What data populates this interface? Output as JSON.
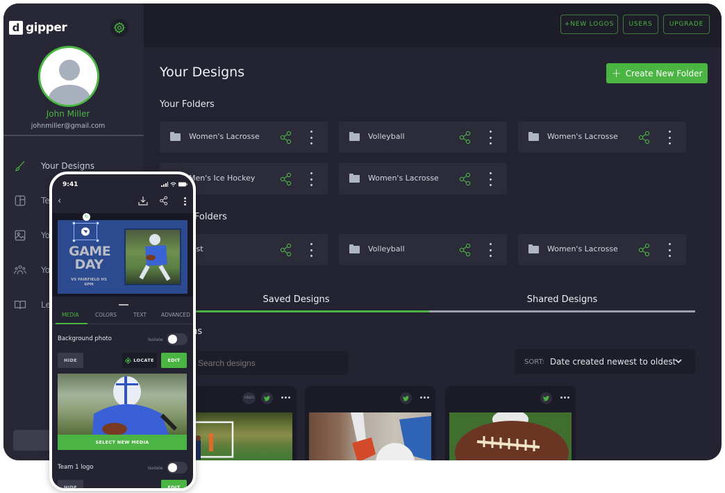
{
  "brand": {
    "name": "gipper",
    "logo_glyph": "d",
    "accent": "#4bb543"
  },
  "sidebar": {
    "settings_icon": "gear-icon",
    "user": {
      "name": "John Miller",
      "email": "johnmiller@gmail.com"
    },
    "items": [
      {
        "label": "Your Designs",
        "icon": "paintbrush-icon",
        "active": true
      },
      {
        "label": "Templates",
        "icon": "template-icon",
        "visible_text": "Te"
      },
      {
        "label": "Your Media",
        "icon": "image-icon",
        "visible_text": "Yo"
      },
      {
        "label": "Your Team",
        "icon": "users-icon",
        "visible_text": "Yo"
      },
      {
        "label": "Learn",
        "icon": "book-icon",
        "visible_text": "Le"
      }
    ]
  },
  "topbar": {
    "buttons": [
      {
        "label": "+NEW LOGOS"
      },
      {
        "label": "USERS"
      },
      {
        "label": "UPGRADE"
      }
    ]
  },
  "main": {
    "title": "Your Designs",
    "create_folder_label": "Create New Folder",
    "your_folders": {
      "title": "Your Folders",
      "items": [
        {
          "name": "Women's Lacrosse"
        },
        {
          "name": "Volleyball"
        },
        {
          "name": "Women's Lacrosse"
        },
        {
          "name": "Men's Ice Hockey",
          "visible_text": "len's Ice Hockey"
        },
        {
          "name": "Women's Lacrosse"
        }
      ]
    },
    "shared_folders": {
      "title": "Shared Folders",
      "visible_title": "ders",
      "items": [
        {
          "name": "...st",
          "visible_text": "st"
        },
        {
          "name": "Volleyball"
        },
        {
          "name": "Women's Lacrosse"
        }
      ]
    },
    "tabs": [
      {
        "label": "Saved Designs",
        "active": true
      },
      {
        "label": "Shared Designs",
        "active": false
      }
    ],
    "designs_title_visible": "r Designs",
    "search": {
      "placeholder": "Search designs"
    },
    "sort": {
      "label": "SORT:",
      "value": "Date created newest to oldest"
    },
    "cards": [
      {
        "video_badge": "VIDEO",
        "social": "twitter-icon",
        "thumb": "soccer-field"
      },
      {
        "social": "twitter-icon",
        "thumb": "soccer-kick"
      },
      {
        "social": "twitter-icon",
        "thumb": "football-wilson"
      }
    ]
  },
  "phone": {
    "time": "9:41",
    "design": {
      "headline": "GAME DAY",
      "line1": "VS FAIRFIELD HS",
      "line2": "6PM"
    },
    "tabs": [
      {
        "label": "MEDIA",
        "active": true
      },
      {
        "label": "COLORS"
      },
      {
        "label": "TEXT"
      },
      {
        "label": "ADVANCED"
      }
    ],
    "background_photo": {
      "label": "Background photo",
      "isolate_label": "Isolate",
      "hide_label": "HIDE",
      "locate_label": "LOCATE",
      "edit_label": "EDIT",
      "select_media_label": "SELECT NEW MEDIA"
    },
    "team_logo": {
      "label": "Team 1 logo",
      "isolate_label": "Isolate",
      "hide_label": "HIDE",
      "edit_label": "EDIT"
    }
  }
}
